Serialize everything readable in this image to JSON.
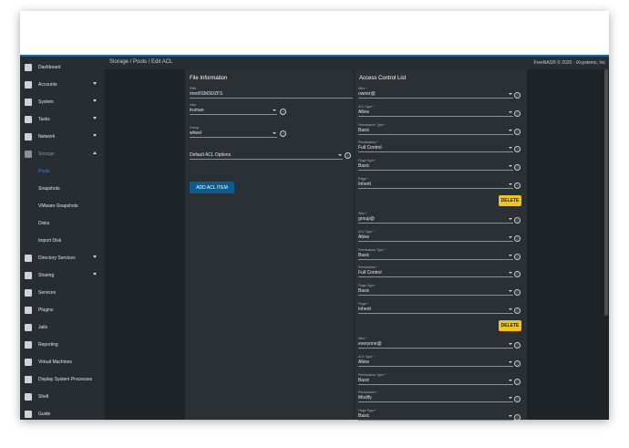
{
  "breadcrumb": "Storage  /  Pools  /  Edit ACL",
  "copyright": "FreeNAS® © 2020 - iXsystems, Inc",
  "sidebar": {
    "items": [
      {
        "label": "Dashboard",
        "icon": "dashboard-icon"
      },
      {
        "label": "Accounts",
        "icon": "accounts-icon"
      },
      {
        "label": "System",
        "icon": "system-icon"
      },
      {
        "label": "Tasks",
        "icon": "tasks-icon"
      },
      {
        "label": "Network",
        "icon": "network-icon"
      },
      {
        "label": "Storage",
        "icon": "storage-icon"
      },
      {
        "label": "Pools"
      },
      {
        "label": "Snapshots"
      },
      {
        "label": "VMware-Snapshots"
      },
      {
        "label": "Disks"
      },
      {
        "label": "Import Disk"
      },
      {
        "label": "Directory Services",
        "icon": "directory-services-icon"
      },
      {
        "label": "Sharing",
        "icon": "sharing-icon"
      },
      {
        "label": "Services",
        "icon": "services-icon"
      },
      {
        "label": "Plugins",
        "icon": "plugins-icon"
      },
      {
        "label": "Jails",
        "icon": "jails-icon"
      },
      {
        "label": "Reporting",
        "icon": "reporting-icon"
      },
      {
        "label": "Virtual Machines",
        "icon": "virtual-machines-icon"
      },
      {
        "label": "Display System Processes",
        "icon": "processes-icon"
      },
      {
        "label": "Shell",
        "icon": "shell-icon"
      },
      {
        "label": "Guide",
        "icon": "guide-icon"
      }
    ]
  },
  "file_info": {
    "title": "File Information",
    "path_label": "Path",
    "path_value": "/mnt/ISM30/ZFS",
    "user_label": "User",
    "user_value": "truman",
    "group_label": "Group",
    "group_value": "wheel",
    "default_acl_label": "Default ACL Options",
    "add_button": "ADD ACL ITEM"
  },
  "acl": {
    "title": "Access Control List",
    "who_label": "Who *",
    "acl_type_label": "ACL Type *",
    "perm_type_label": "Permissions Type *",
    "perm_label": "Permissions *",
    "flags_type_label": "Flags Type *",
    "flags_label": "Flags *",
    "delete_label": "DELETE",
    "entries": [
      {
        "who": "owner@",
        "acl_type": "Allow",
        "perm_type": "Basic",
        "perms": "Full Control",
        "flags_type": "Basic",
        "flags": "Inherit"
      },
      {
        "who": "group@",
        "acl_type": "Allow",
        "perm_type": "Basic",
        "perms": "Full Control",
        "flags_type": "Basic",
        "flags": "Inherit"
      },
      {
        "who": "everyone@",
        "acl_type": "Allow",
        "perm_type": "Basic",
        "perms": "Modify",
        "flags_type": "Basic"
      }
    ]
  }
}
